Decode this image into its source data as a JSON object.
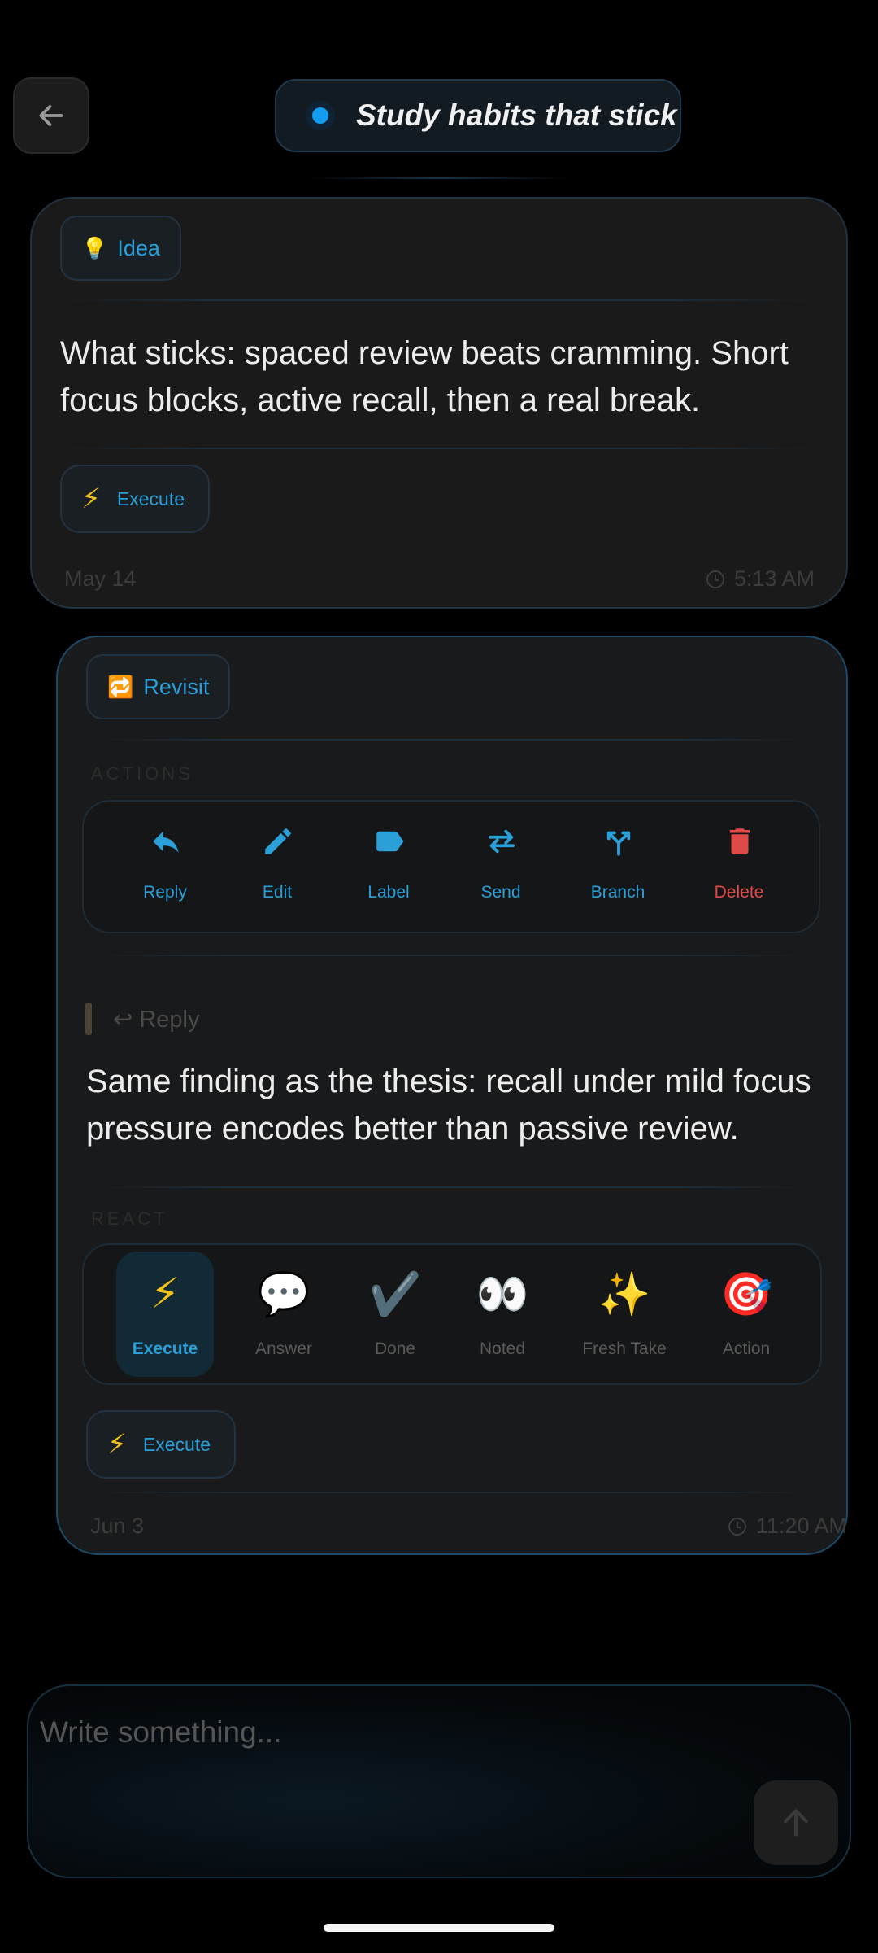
{
  "header": {
    "title": "Study habits that stick"
  },
  "messages": [
    {
      "tag": {
        "icon": "lightbulb",
        "emoji": "💡",
        "label": "Idea"
      },
      "text": "What sticks: spaced review beats cramming. Short focus blocks, active recall, then a real break.",
      "action_button": {
        "icon": "⚡",
        "label": "Execute"
      },
      "date": "May 14",
      "time": "5:13 AM"
    },
    {
      "tag": {
        "icon": "repeat",
        "emoji": "🔁",
        "label": "Revisit"
      },
      "actions_label": "ACTIONS",
      "actions": [
        {
          "label": "Reply",
          "icon": "reply-icon"
        },
        {
          "label": "Edit",
          "icon": "pencil-icon"
        },
        {
          "label": "Label",
          "icon": "label-icon"
        },
        {
          "label": "Send",
          "icon": "swap-arrows-icon"
        },
        {
          "label": "Branch",
          "icon": "branch-icon"
        },
        {
          "label": "Delete",
          "icon": "trash-icon"
        }
      ],
      "reply_ref": "↩ Reply",
      "text": "Same finding as the thesis: recall under mild focus pressure encodes better than passive review.",
      "react_label": "REACT",
      "reactions": [
        {
          "emoji": "⚡",
          "label": "Execute",
          "active": true
        },
        {
          "emoji": "💬",
          "label": "Answer"
        },
        {
          "emoji": "✔️",
          "label": "Done"
        },
        {
          "emoji": "👀",
          "label": "Noted"
        },
        {
          "emoji": "✨",
          "label": "Fresh Take"
        },
        {
          "emoji": "🎯",
          "label": "Action"
        }
      ],
      "action_button": {
        "icon": "⚡",
        "label": "Execute"
      },
      "date": "Jun 3",
      "time": "11:20 AM"
    }
  ],
  "composer": {
    "placeholder": "Write something..."
  },
  "colors": {
    "accent": "#2b9fd8",
    "danger": "#e04a48",
    "bolt": "#f4c21a"
  }
}
